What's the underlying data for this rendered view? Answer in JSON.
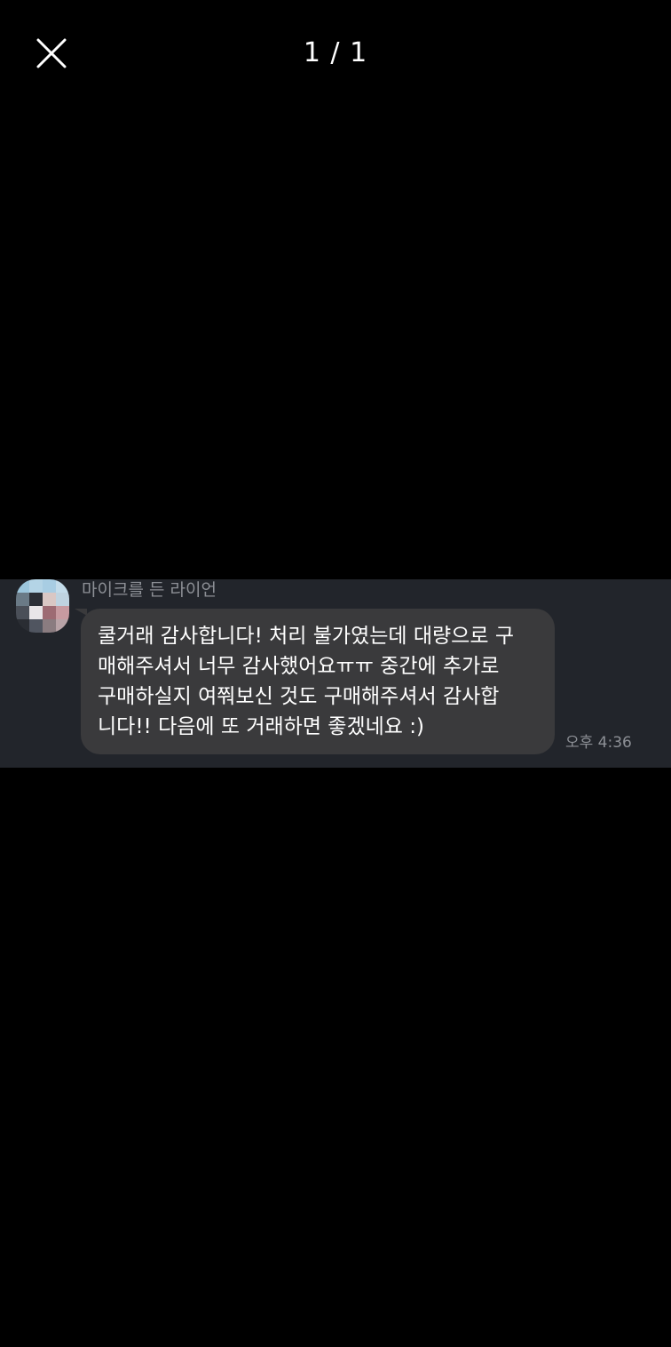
{
  "header": {
    "page_counter": "1 / 1"
  },
  "message": {
    "sender_name": "마이크를 든 라이언",
    "text_lines": [
      "쿨거래 감사합니다! 처리 불가였는데 대량으로 구",
      "매해주셔서 너무 감사했어요ㅠㅠ 중간에 추가로",
      "구매하실지 여쭤보신 것도 구매해주셔서 감사합",
      "니다!! 다음에 또 거래하면 좋겠네요 :)"
    ],
    "timestamp": "오후 4:36"
  },
  "colors": {
    "background": "#000000",
    "chat_background": "#22252b",
    "bubble": "#3a3a3c",
    "secondary_text": "#8d9096",
    "primary_text": "#ffffff"
  },
  "icons": {
    "close": "close-icon",
    "avatar": "pixelated-profile-avatar"
  }
}
